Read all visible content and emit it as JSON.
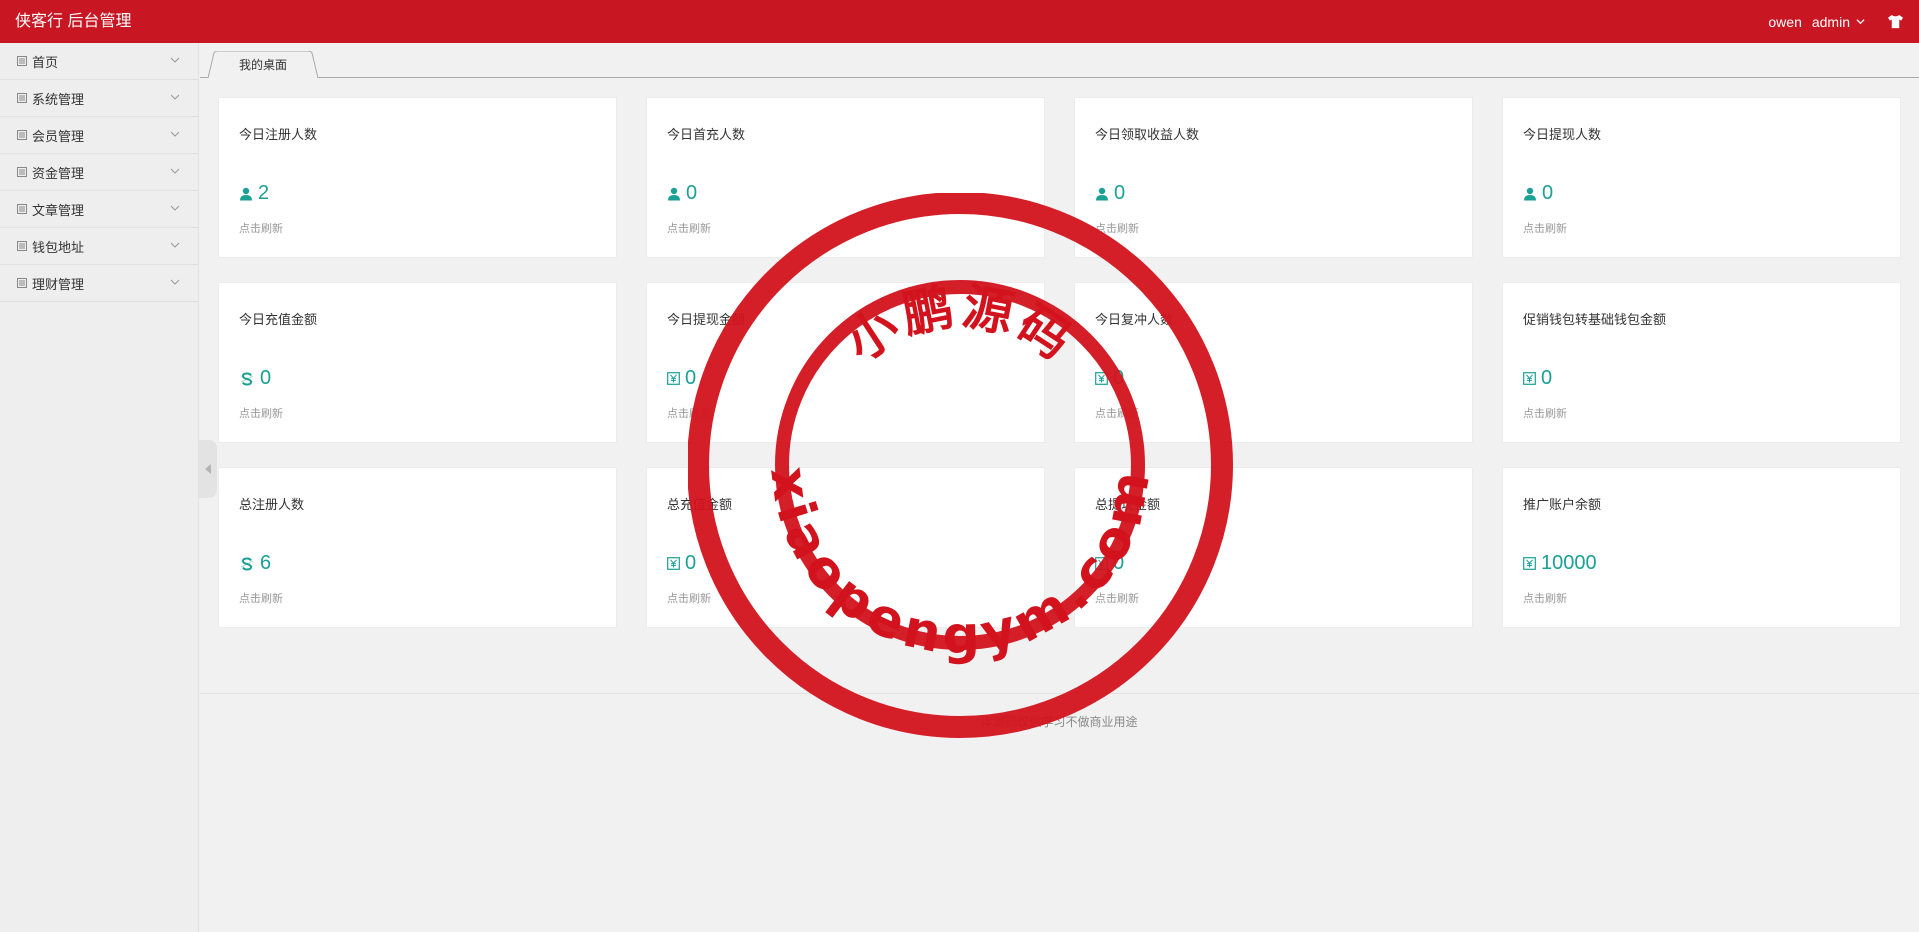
{
  "header": {
    "brand": "侠客行 后台管理",
    "user_name": "owen",
    "user_role": "admin",
    "accent_color": "#c81623"
  },
  "sidebar": {
    "items": [
      {
        "label": "首页"
      },
      {
        "label": "系统管理"
      },
      {
        "label": "会员管理"
      },
      {
        "label": "资金管理"
      },
      {
        "label": "文章管理"
      },
      {
        "label": "钱包地址"
      },
      {
        "label": "理财管理"
      }
    ]
  },
  "tabs": [
    {
      "label": "我的桌面",
      "active": true
    }
  ],
  "cards": [
    {
      "title": "今日注册人数",
      "value": "2",
      "icon": "user-icon",
      "refresh": "点击刷新"
    },
    {
      "title": "今日首充人数",
      "value": "0",
      "icon": "user-icon",
      "refresh": "点击刷新"
    },
    {
      "title": "今日领取收益人数",
      "value": "0",
      "icon": "user-icon",
      "refresh": "点击刷新"
    },
    {
      "title": "今日提现人数",
      "value": "0",
      "icon": "user-icon",
      "refresh": "点击刷新"
    },
    {
      "title": "今日充值金额",
      "value": "0",
      "icon": "dollar-icon",
      "refresh": "点击刷新"
    },
    {
      "title": "今日提现金额",
      "value": "0",
      "icon": "yen-icon",
      "refresh": "点击刷新"
    },
    {
      "title": "今日复冲人数",
      "value": "0",
      "icon": "yen-icon",
      "refresh": "点击刷新"
    },
    {
      "title": "促销钱包转基础钱包金额",
      "value": "0",
      "icon": "yen-icon",
      "refresh": "点击刷新"
    },
    {
      "title": "总注册人数",
      "value": "6",
      "icon": "dollar-icon",
      "refresh": "点击刷新"
    },
    {
      "title": "总充值金额",
      "value": "0",
      "icon": "yen-icon",
      "refresh": "点击刷新"
    },
    {
      "title": "总提现金额",
      "value": "0",
      "icon": "yen-icon",
      "refresh": "点击刷新"
    },
    {
      "title": "推广账户余额",
      "value": "10000",
      "icon": "yen-icon",
      "refresh": "点击刷新"
    }
  ],
  "footer": {
    "text": "本源码仅供学习不做商业用途"
  },
  "watermark": {
    "top_text": "小鹏源码",
    "bottom_text": "xiaopengym.com",
    "color": "#d2121c"
  },
  "value_color": "#1aa094"
}
